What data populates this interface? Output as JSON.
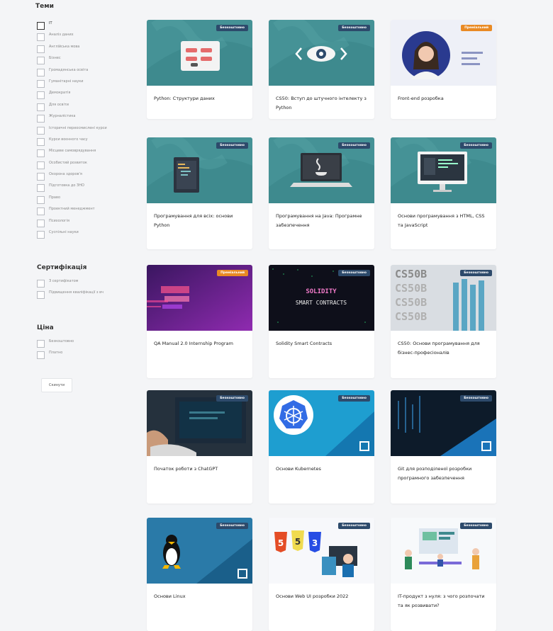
{
  "sidebar": {
    "topics_title": "Теми",
    "topics": [
      "IT",
      "Аналіз даних",
      "Англійська мова",
      "Бізнес",
      "Громадянська освіта",
      "Гуманітарні науки",
      "Демократія",
      "Для освіти",
      "Журналістика",
      "Історичні переосмислені курси",
      "Курси воєнного часу",
      "Місцеве самоврядування",
      "Особистий розвиток",
      "Охорона здоров'я",
      "Підготовка до ЗНО",
      "Право",
      "Проектний менеджмент",
      "Психологія",
      "Суспільні науки"
    ],
    "cert_title": "Сертифікація",
    "cert_options": [
      "З сертифікатом",
      "Підвищення кваліфікації з вч"
    ],
    "price_title": "Ціна",
    "price_options": [
      "Безкоштовно",
      "Платно"
    ],
    "reset_label": "Скинути"
  },
  "colors": {
    "free_badge": "#2d4a6b",
    "premium_badge": "#e98a24",
    "teal": "#3f8a8f"
  },
  "courses": [
    {
      "title": "Python: Структури даних",
      "badge": "Безкоштовно",
      "image": "python-structures-icon"
    },
    {
      "title": "CS50: Вступ до штучного інтелекту з Python",
      "badge": "Безкоштовно",
      "image": "eye-icon"
    },
    {
      "title": "Front-end розробка",
      "badge": "Преміальний",
      "image": "instructor-portrait"
    },
    {
      "title": "Програмування для всіх: основи Python",
      "badge": "Безкоштовно",
      "image": "code-tablet-icon"
    },
    {
      "title": "Програмування на Java: Програмне забезпечення",
      "badge": "Безкоштовно",
      "image": "java-laptop-icon"
    },
    {
      "title": "Основи програмування з HTML, CSS та JavaScript",
      "badge": "Безкоштовно",
      "image": "monitor-icon"
    },
    {
      "title": "QA Manual 2.0 Internship Program",
      "badge": "Преміальний",
      "image": "qa-neon"
    },
    {
      "title": "Solidity Smart Contracts",
      "badge": "Безкоштовно",
      "image": "solidity-banner",
      "banner_line1": "SOLIDITY",
      "banner_line2": "SMART CONTRACTS"
    },
    {
      "title": "CS50: Основи програмування для бізнес-професіоналів",
      "badge": "Безкоштовно",
      "image": "cs50b-banner",
      "banner_text": "CS50B"
    },
    {
      "title": "Початок роботи з ChatGPT",
      "badge": "Безкоштовно",
      "image": "laptop-photo"
    },
    {
      "title": "Основи Kubernetes",
      "badge": "Безкоштовно",
      "image": "kubernetes-icon"
    },
    {
      "title": "Git для розподіленої розробки програмного забезпечення",
      "badge": "Безкоштовно",
      "image": "server-photo"
    },
    {
      "title": "Основи Linux",
      "badge": "Безкоштовно",
      "image": "linux-penguin-icon"
    },
    {
      "title": "Основи Web UI розробки 2022",
      "badge": "Безкоштовно",
      "image": "html-css-js-icons"
    },
    {
      "title": "IT-продукт з нуля: з чого розпочати та як розвивати?",
      "badge": "Безкоштовно",
      "image": "team-illustration"
    }
  ]
}
